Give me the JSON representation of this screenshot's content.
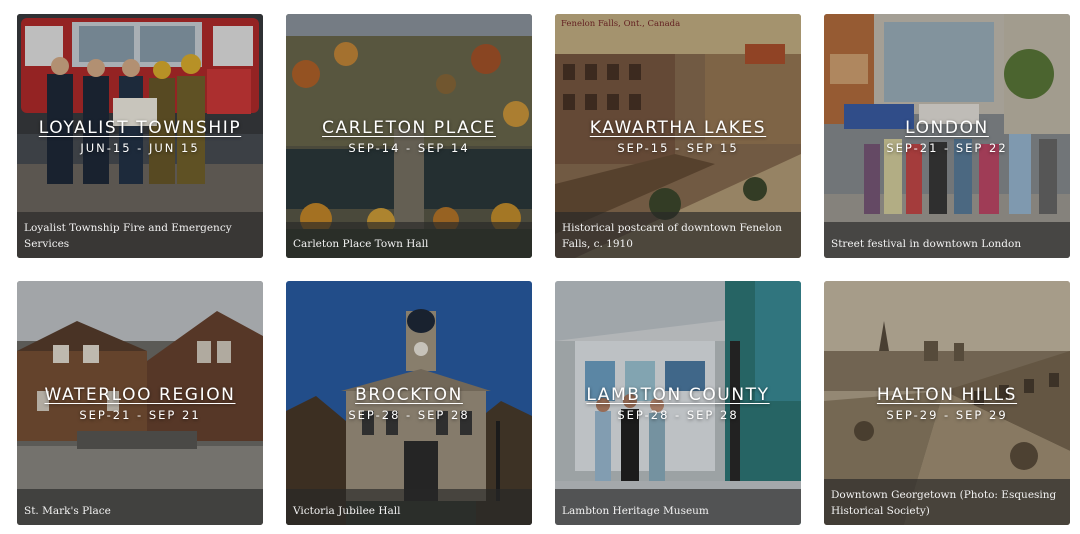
{
  "cards": [
    {
      "title": "LOYALIST TOWNSHIP",
      "dates": "JUN-15 - JUN 15",
      "caption": "Loyalist Township Fire and Emergency Services",
      "photo": "firefighters-photo"
    },
    {
      "title": "CARLETON PLACE",
      "dates": "SEP-14 - SEP 14",
      "caption": "Carleton Place Town Hall",
      "photo": "aerial-town-photo"
    },
    {
      "title": "KAWARTHA LAKES",
      "dates": "SEP-15 - SEP 15",
      "caption": "Historical postcard of downtown Fenelon Falls, c. 1910",
      "photo": "postcard-photo",
      "photo_text": "Fenelon Falls, Ont., Canada"
    },
    {
      "title": "LONDON",
      "dates": "SEP-21 - SEP 22",
      "caption": "Street festival in downtown London",
      "photo": "street-festival-photo"
    },
    {
      "title": "WATERLOO REGION",
      "dates": "SEP-21 - SEP 21",
      "caption": "St. Mark's Place",
      "photo": "brick-building-photo"
    },
    {
      "title": "BROCKTON",
      "dates": "SEP-28 - SEP 28",
      "caption": "Victoria Jubilee Hall",
      "photo": "clock-tower-photo"
    },
    {
      "title": "LAMBTON COUNTY",
      "dates": "SEP-28 - SEP 28",
      "caption": "Lambton Heritage Museum",
      "photo": "museum-photo"
    },
    {
      "title": "HALTON HILLS",
      "dates": "SEP-29 - SEP 29",
      "caption": "Downtown Georgetown (Photo: Esquesing Historical Society)",
      "photo": "sepia-street-photo"
    }
  ]
}
